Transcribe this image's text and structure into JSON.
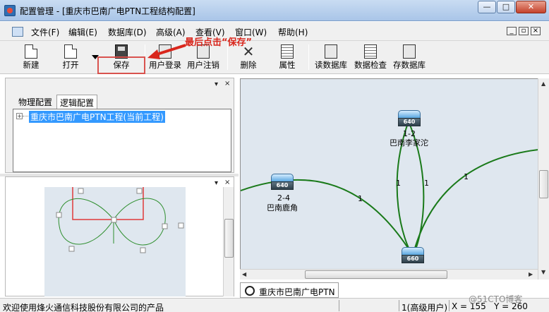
{
  "window": {
    "title": "配置管理 - [重庆市巴南广电PTN工程结构配置]",
    "controls": {
      "minimize": "—",
      "maximize": "□",
      "close": "✕"
    }
  },
  "menu": {
    "items": [
      "文件(F)",
      "编辑(E)",
      "数据库(D)",
      "高级(A)",
      "查看(V)",
      "窗口(W)",
      "帮助(H)"
    ],
    "mdi": {
      "minimize": "_",
      "restore": "▫",
      "close": "×"
    }
  },
  "toolbar": {
    "buttons": [
      "新建",
      "打开",
      "保存",
      "用户登录",
      "用户注销",
      "删除",
      "属性",
      "读数据库",
      "数据检查",
      "存数据库"
    ],
    "annotation": "最后点击“保存”"
  },
  "left_panel": {
    "tabs": [
      "物理配置",
      "逻辑配置"
    ],
    "active_tab": "逻辑配置",
    "tree_node": "重庆市巴南广电PTN工程(当前工程)",
    "pin": "▾",
    "close": "×"
  },
  "canvas": {
    "devices": [
      {
        "model": "640",
        "id": "1-2",
        "name": "巴南李家沱"
      },
      {
        "model": "640",
        "id": "2-4",
        "name": "巴南鹿角"
      },
      {
        "model": "660",
        "id": "",
        "name": ""
      }
    ],
    "link_labels": [
      "1",
      "1",
      "1",
      "1"
    ],
    "link_color": "#1a7a1a"
  },
  "bottom_tab": {
    "label": "重庆市巴南广电PTN"
  },
  "status": {
    "welcome": "欢迎使用烽火通信科技股份有限公司的产品",
    "user": "1(高级用户)",
    "x": "X = 155",
    "y": "Y = 260"
  },
  "watermark": "@51CTO博客"
}
